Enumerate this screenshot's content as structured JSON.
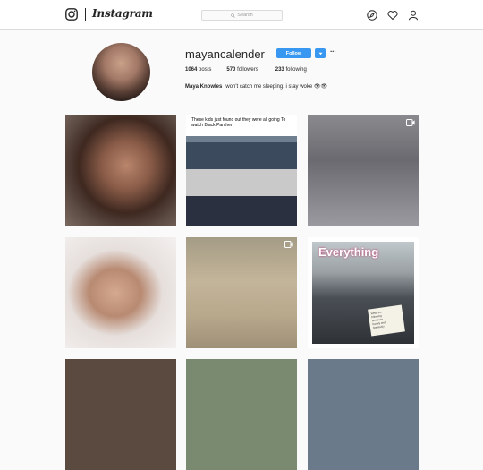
{
  "app": {
    "wordmark": "Instagram"
  },
  "search": {
    "placeholder": "Search"
  },
  "profile": {
    "username": "mayancalender",
    "follow_label": "Follow",
    "more_label": "···",
    "stats": {
      "posts_count": "1064",
      "posts_label": "posts",
      "followers_count": "570",
      "followers_label": "followers",
      "following_count": "233",
      "following_label": "following"
    },
    "bio": {
      "name": "Maya Knowles",
      "text": "won't catch me sleeping. i stay woke 👁👁"
    }
  },
  "posts": {
    "meme_caption": "These kids just found out they were all going To watch Black Panther",
    "sign_text": "Everything",
    "card_lines": [
      "Wear the",
      "following",
      "sentence",
      "frankly and",
      "fearlessly"
    ]
  },
  "colors": {
    "accent": "#3897f0",
    "border": "#dbdbdb",
    "background": "#fafafa"
  },
  "icons": [
    "instagram-camera-icon",
    "search-icon",
    "compass-icon",
    "heart-icon",
    "profile-icon",
    "video-icon",
    "chevron-down-icon"
  ]
}
